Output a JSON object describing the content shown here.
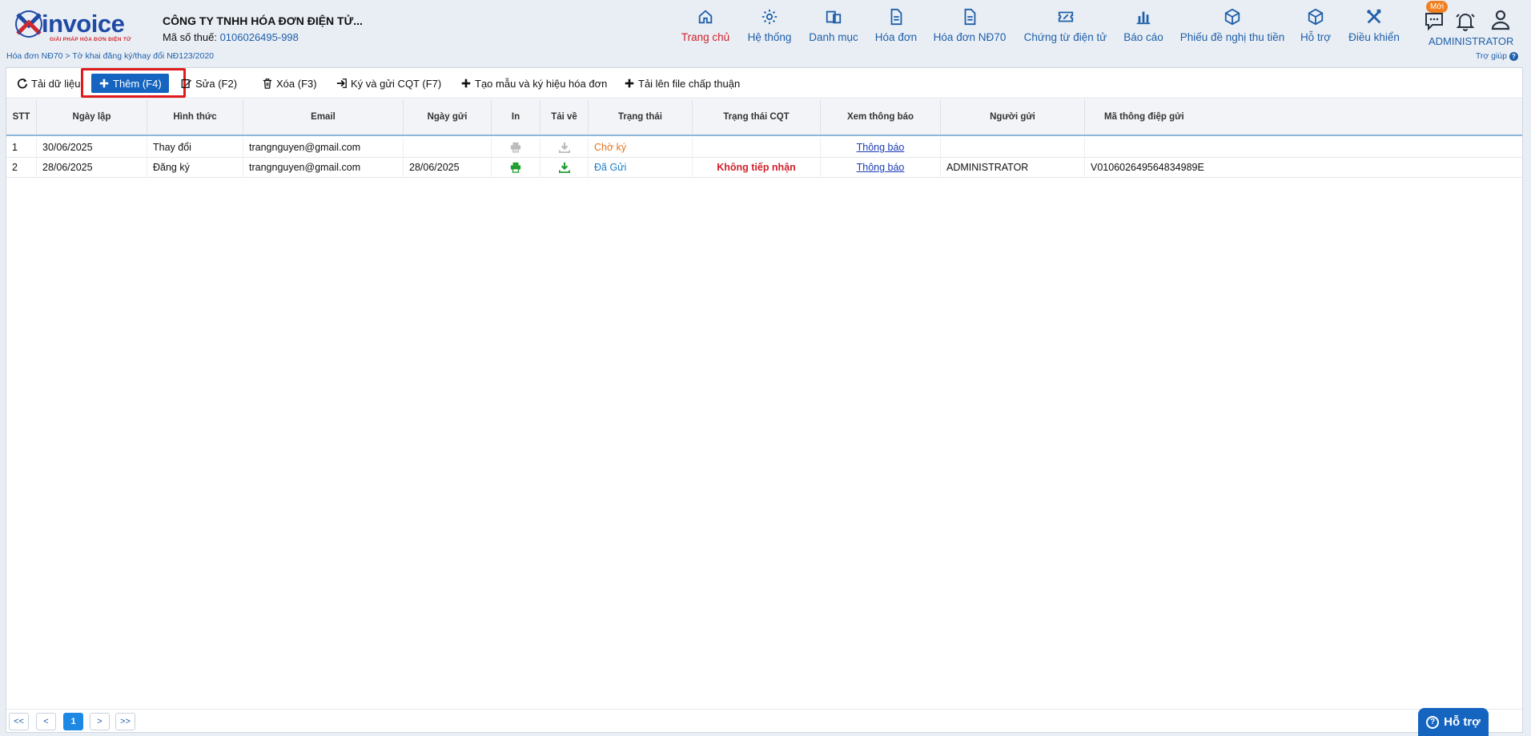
{
  "header": {
    "logo_text": "invoice",
    "logo_tagline": "GIẢI PHÁP HÓA ĐƠN ĐIỆN TỬ",
    "company_name": "CÔNG TY TNHH HÓA ĐƠN ĐIỆN TỬ...",
    "tax_label": "Mã số thuế:",
    "tax_code": "0106026495-998",
    "nav": [
      {
        "label": "Trang chủ",
        "icon": "home-icon"
      },
      {
        "label": "Hệ thống",
        "icon": "gear-icon"
      },
      {
        "label": "Danh mục",
        "icon": "catalog-icon"
      },
      {
        "label": "Hóa đơn",
        "icon": "document-icon"
      },
      {
        "label": "Hóa đơn NĐ70",
        "icon": "document-icon"
      },
      {
        "label": "Chứng từ điện tử",
        "icon": "ticket-icon"
      },
      {
        "label": "Báo cáo",
        "icon": "bar-chart-icon"
      },
      {
        "label": "Phiếu đề nghị thu tiền",
        "icon": "box-icon"
      },
      {
        "label": "Hỗ trợ",
        "icon": "box-icon"
      },
      {
        "label": "Điều khiển",
        "icon": "tools-icon"
      }
    ],
    "badge": "Mới",
    "user": "ADMINISTRATOR"
  },
  "breadcrumb": "Hóa đơn NĐ70 > Tờ khai đăng ký/thay đổi NĐ123/2020",
  "help_link": "Trợ giúp",
  "toolbar": {
    "reload": "Tải dữ liệu",
    "add": "Thêm (F4)",
    "edit": "Sửa (F2)",
    "delete": "Xóa (F3)",
    "sign_send": "Ký và gửi CQT (F7)",
    "create_template": "Tạo mẫu và ký hiệu hóa đơn",
    "upload": "Tải lên file chấp thuận"
  },
  "table": {
    "columns": [
      "STT",
      "Ngày lập",
      "Hình thức",
      "Email",
      "Ngày gửi",
      "In",
      "Tải về",
      "Trạng thái",
      "Trạng thái CQT",
      "Xem thông báo",
      "Người gửi",
      "Mã thông điệp gửi"
    ],
    "rows": [
      {
        "stt": "1",
        "date": "30/06/2025",
        "type": "Thay đổi",
        "email": "trangnguyen@gmail.com",
        "sent_date": "",
        "status": "Chờ ký",
        "cqt_status": "",
        "notice": "Thông báo",
        "sender": "",
        "message_id": ""
      },
      {
        "stt": "2",
        "date": "28/06/2025",
        "type": "Đăng ký",
        "email": "trangnguyen@gmail.com",
        "sent_date": "28/06/2025",
        "status": "Đã Gửi",
        "cqt_status": "Không tiếp nhận",
        "notice": "Thông báo",
        "sender": "ADMINISTRATOR",
        "message_id": "V010602649564834989E"
      }
    ]
  },
  "pager": {
    "first": "<<",
    "prev": "<",
    "current": "1",
    "next": ">",
    "last": ">>"
  },
  "support_button": "Hỗ trợ",
  "colors": {
    "brand_blue": "#1565c0",
    "active_red": "#d0212a",
    "pending_orange": "#e2731f"
  }
}
